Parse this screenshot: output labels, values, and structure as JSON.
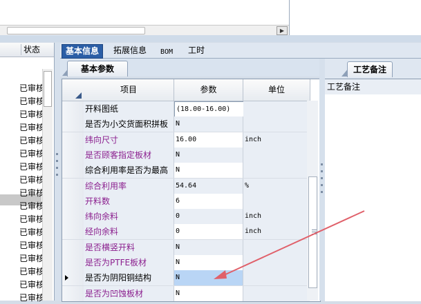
{
  "left_panel": {
    "header_status": "状态",
    "rows": [
      "已审核",
      "已审核",
      "已审核",
      "已审核",
      "已审核",
      "已审核",
      "已审核",
      "已审核",
      "已审核",
      "已审核",
      "已审核",
      "已审核",
      "已审核",
      "已审核",
      "已审核",
      "已审核",
      "已审核"
    ]
  },
  "tabs": [
    "基本信息",
    "拓展信息",
    "BOM",
    "工时"
  ],
  "sub_tab": "基本参数",
  "grid": {
    "headers": {
      "item": "项目",
      "param": "参数",
      "unit": "单位"
    },
    "rows": [
      {
        "item": "开料图纸",
        "param": "(18.00-16.00)",
        "unit": "",
        "purple": false
      },
      {
        "item": "是否为小交货面积拼板",
        "param": "N",
        "unit": "",
        "purple": false
      },
      {
        "item": "纬向尺寸",
        "param": "16.00",
        "unit": "inch",
        "purple": true
      },
      {
        "item": "是否顾客指定板材",
        "param": "N",
        "unit": "",
        "purple": true
      },
      {
        "item": "综合利用率是否为最高",
        "param": "N",
        "unit": "",
        "purple": false
      },
      {
        "item": "综合利用率",
        "param": "54.64",
        "unit": "%",
        "purple": true
      },
      {
        "item": "开料数",
        "param": "6",
        "unit": "",
        "purple": true
      },
      {
        "item": "纬向余料",
        "param": "0",
        "unit": "inch",
        "purple": true
      },
      {
        "item": "经向余料",
        "param": "0",
        "unit": "inch",
        "purple": true
      },
      {
        "item": "是否横竖开料",
        "param": "N",
        "unit": "",
        "purple": true
      },
      {
        "item": "是否为PTFE板材",
        "param": "N",
        "unit": "",
        "purple": true
      },
      {
        "item": "是否为阴阳铜结构",
        "param": "N",
        "unit": "",
        "purple": false
      },
      {
        "item": "是否为凹蚀板材",
        "param": "N",
        "unit": "",
        "purple": true
      }
    ]
  },
  "right_panel": {
    "tab": "工艺备注",
    "label": "工艺备注"
  },
  "colors": {
    "accent": "#2b5ea6",
    "purple_text": "#8b1f8e",
    "arrow": "#e0606a",
    "selected": "#b9d5f5"
  }
}
